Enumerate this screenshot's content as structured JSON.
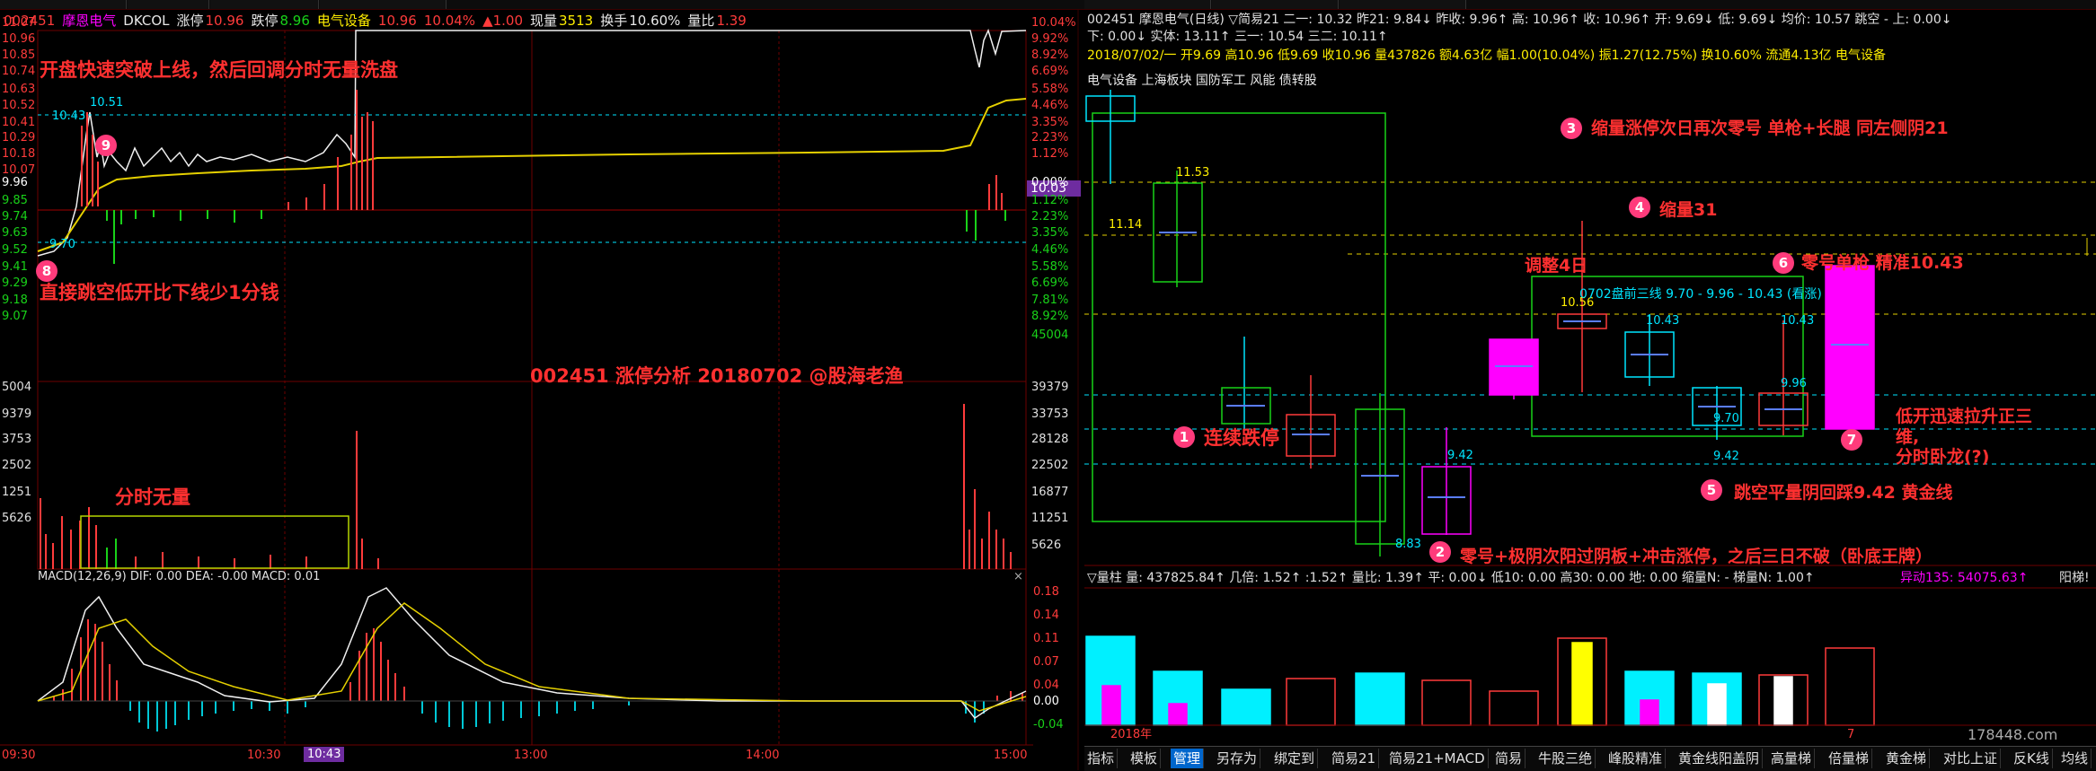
{
  "left": {
    "header": {
      "code": "002451",
      "name": "摩恩电气",
      "indicator": "DKCOL",
      "limit_up_label": "涨停",
      "limit_up": "10.96",
      "limit_down_label": "跌停",
      "limit_down": "8.96",
      "sector": "电气设备",
      "price": "10.96",
      "pct": "10.04%",
      "change": "▲1.00",
      "vol_label": "现量",
      "vol": "3513",
      "turnover_label": "换手",
      "turnover": "10.60%",
      "volratio_label": "量比",
      "volratio": "1.39"
    },
    "price_axis_left": [
      "11.07",
      "10.96",
      "10.85",
      "10.74",
      "10.63",
      "10.52",
      "10.41",
      "10.29",
      "10.18",
      "10.07",
      "9.96",
      "9.85",
      "9.74",
      "9.63",
      "9.52",
      "9.41",
      "9.29",
      "9.18",
      "9.07",
      "5004",
      "9379",
      "3753",
      "2502",
      "1251",
      "5626"
    ],
    "pct_axis_right": [
      "10.04%",
      "9.92%",
      "8.92%",
      "6.69%",
      "5.58%",
      "4.46%",
      "3.35%",
      "2.23%",
      "1.12%",
      "0.00%",
      "1.12%",
      "2.23%",
      "3.35%",
      "4.46%",
      "5.58%",
      "6.69%",
      "7.81%",
      "8.92%",
      "45004",
      "39379",
      "33753",
      "28128",
      "22502",
      "16877",
      "11251",
      "5626"
    ],
    "current_price_tag": "10.03",
    "price_labels": {
      "high": "10.51",
      "avg_line": "10.43",
      "low": "9.70"
    },
    "macd_header": "MACD(12,26,9)  DIF: 0.00  DEA: -0.00  MACD: 0.01",
    "macd_axis": [
      "0.18",
      "0.14",
      "0.11",
      "0.07",
      "0.04",
      "0.00",
      "-0.04"
    ],
    "time_axis": [
      "09:30",
      "10:30",
      "10:43",
      "13:00",
      "14:00",
      "15:00"
    ],
    "annotations": {
      "a1": "开盘快速突破上线，然后回调分时无量洗盘",
      "a2": "直接跳空低开比下线少1分钱",
      "a3": "002451 涨停分析 20180702 @股海老渔",
      "a4": "分时无量"
    },
    "badges": {
      "b8": "8",
      "b9": "9"
    }
  },
  "right": {
    "header1": "002451 摩恩电气(日线) ▽简易21  二一: 10.32  昨21: 9.84↓  昨收: 9.96↑  高: 10.96↑  收: 10.96↑  开: 9.69↓  低: 9.69↓  均价: 10.57  跳空 - 上: 0.00↓",
    "header2": "下: 0.00↓  实体: 13.11↑  三一: 10.54  三二: 10.11↑",
    "header3": "2018/07/02/一  开9.69  高10.96  低9.69  收10.96  量437826  额4.63亿  幅1.00(10.04%)  振1.27(12.75%)  换10.60%  流通4.13亿  电气设备",
    "concepts": "电气设备  上海板块  国防军工  风能  债转股",
    "zone_label": "0702盘前三线 9.70 - 9.96 - 10.43 (看涨)",
    "price_marks": [
      "11.53",
      "11.14",
      "10.56",
      "10.43",
      "10.43",
      "9.96",
      "9.70",
      "9.42",
      "9.42",
      "8.83"
    ],
    "annotations": {
      "r1": "连续跌停",
      "r2": "零号+极阴次阳过阴板+冲击涨停，之后三日不破（卧底王牌）",
      "r3": "缩量涨停次日再次零号 单枪+长腿 同左侧阴21",
      "r4": "缩量31",
      "r5": "跳空平量阴回踩9.42 黄金线",
      "r6": "零号单枪 精准10.43",
      "r7a": "低开迅速拉升正三",
      "r7b": "维,",
      "r7c": "分时卧龙(?)",
      "adjust": "调整4日"
    },
    "vol_header": "▽量柱  量: 437825.84↑  几倍: 1.52↑  :1.52↑  量比: 1.39↑  平: 0.00↓  低10: 0.00  高30: 0.00  地: 0.00  缩量N: -  梯量N: 1.00↑",
    "vol_header_right": "异动135: 54075.63↑",
    "vol_header_far": "阳梯!",
    "year_label": "2018年",
    "month_label": "7",
    "watermark": "178448.com",
    "tabs": [
      "指标",
      "模板",
      "管理",
      "另存为",
      "绑定到",
      "简易21",
      "简易21+MACD",
      "简易",
      "牛股三绝",
      "峰股精准",
      "黄金线阳盖阴",
      "高量梯",
      "倍量梯",
      "黄金梯",
      "对比上证",
      "反K线",
      "均线"
    ],
    "active_tab": "管理"
  },
  "colors": {
    "up": "#ff3b3b",
    "down": "#19d219",
    "avg": "#ffee00",
    "accent": "#ff00ff",
    "cyan": "#00e5ff",
    "grid": "#6e0000"
  }
}
